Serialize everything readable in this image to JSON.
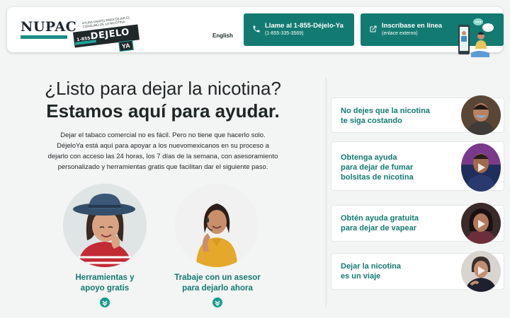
{
  "header": {
    "nupac_logo": "NUPAC",
    "dejelo_tagline": "AYUDA GRATIS PARA DEJAR EL CONSUMO DE LA NICOTINA",
    "dejelo_number": "1-855-",
    "dejelo_word": "DEJELO",
    "dejelo_ya": "YA",
    "language_link": "English",
    "call_button": {
      "title": "Llame al 1-855-Déjelo-Ya",
      "subtitle": "(1-855-335-3569)"
    },
    "signup_button": {
      "title": "Inscríbase en línea",
      "subtitle": "(enlace externo)"
    }
  },
  "hero": {
    "title_line1": "¿Listo para dejar la nicotina?",
    "title_line2": "Estamos aquí para ayudar.",
    "body_line1": "Dejar el tabaco comercial no es fácil. Pero no tiene que hacerlo solo.",
    "body_line2": "DéjeloYa está aquí para apoyar a los nuevomexicanos en su proceso a",
    "body_line3": "dejarlo con acceso las 24 horas, los 7 días de la semana, con asesoramiento",
    "body_line4": "personalizado y herramientas gratis que facilitan dar el siguiente paso."
  },
  "cards": [
    {
      "line1": "Herramientas y",
      "line2": "apoyo gratis"
    },
    {
      "line1": "Trabaje con un asesor",
      "line2": "para dejarlo ahora"
    }
  ],
  "side_cards": [
    {
      "line1": "No dejes que la nicotina",
      "line2": "te siga costando",
      "line3": ""
    },
    {
      "line1": "Obtenga ayuda",
      "line2": "para dejar de fumar",
      "line3": "bolsitas de nicotina"
    },
    {
      "line1": "Obtén ayuda gratuita",
      "line2": "para dejar de vapear",
      "line3": ""
    },
    {
      "line1": "Dejar la nicotina",
      "line2": "es un viaje",
      "line3": ""
    }
  ],
  "colors": {
    "teal": "#137a72",
    "accent": "#1a9a8f",
    "background": "#f3f4f4"
  },
  "icons": [
    "phone-icon",
    "external-link-icon",
    "chevron-down-icon",
    "play-icon"
  ]
}
